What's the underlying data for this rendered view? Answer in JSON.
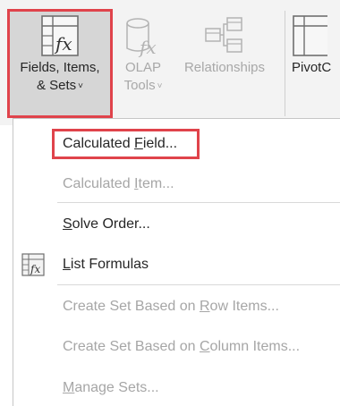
{
  "ribbon": {
    "fields_items_sets": {
      "line1": "Fields, Items,",
      "line2": "& Sets",
      "chevron": "˅"
    },
    "olap_tools": {
      "line1": "OLAP",
      "line2": "Tools",
      "chevron": "˅"
    },
    "relationships": {
      "label": "Relationships"
    },
    "pivotchart": {
      "label": "PivotC"
    }
  },
  "menu": {
    "calculated_field": {
      "pre": "Calculated ",
      "key": "F",
      "post": "ield..."
    },
    "calculated_item": {
      "pre": "Calculated ",
      "key": "I",
      "post": "tem..."
    },
    "solve_order": {
      "pre": "",
      "key": "S",
      "post": "olve Order..."
    },
    "list_formulas": {
      "pre": "",
      "key": "L",
      "post": "ist Formulas"
    },
    "create_set_row": {
      "pre": "Create Set Based on ",
      "key": "R",
      "post": "ow Items..."
    },
    "create_set_column": {
      "pre": "Create Set Based on ",
      "key": "C",
      "post": "olumn Items..."
    },
    "manage_sets": {
      "pre": "",
      "key": "M",
      "post": "anage Sets..."
    }
  },
  "colors": {
    "highlight": "#e0434b",
    "selected_bg": "#d6d6d6",
    "disabled_text": "#a6a6a6"
  },
  "icons": [
    "fields-items-sets-icon",
    "olap-tools-icon",
    "relationships-icon",
    "pivotchart-icon",
    "list-formulas-icon"
  ]
}
